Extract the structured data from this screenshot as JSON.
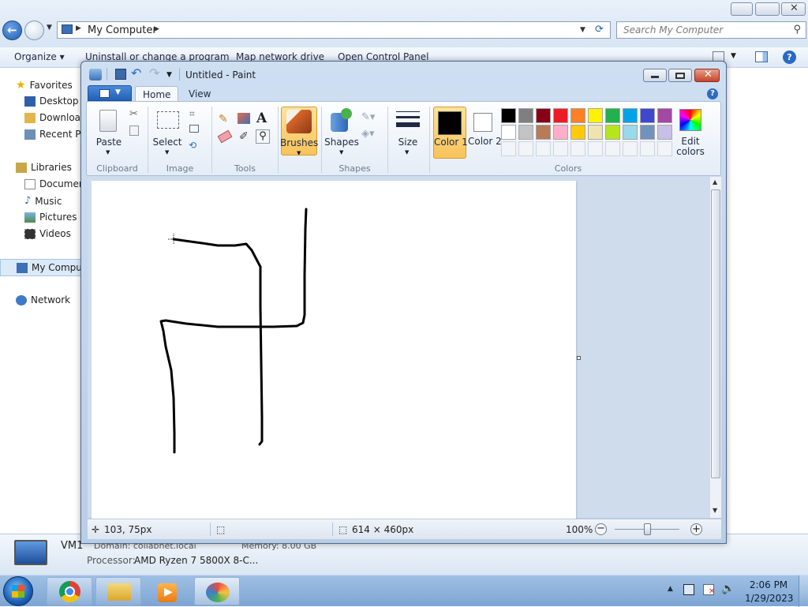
{
  "explorer": {
    "address": "My Computer",
    "search_placeholder": "Search My Computer",
    "commands": [
      "Organize",
      "Uninstall or change a program",
      "Map network drive",
      "Open Control Panel"
    ],
    "nav": {
      "favorites": "Favorites",
      "desktop": "Desktop",
      "downloads": "Download",
      "recent": "Recent Pla",
      "libraries": "Libraries",
      "documents": "Documen",
      "music": "Music",
      "pictures": "Pictures",
      "videos": "Videos",
      "computer": "My Comput",
      "network": "Network"
    },
    "details": {
      "name": "VM1",
      "domain": "Domain:  collabnet.local",
      "memory": "Memory:  8.00 GB",
      "processor_label": "Processor:",
      "processor_value": "AMD Ryzen 7 5800X 8-C..."
    }
  },
  "paint": {
    "title": "Untitled - Paint",
    "tabs": {
      "home": "Home",
      "view": "View"
    },
    "ribbon": {
      "paste": "Paste",
      "select": "Select",
      "brushes": "Brushes",
      "shapes": "Shapes",
      "size": "Size",
      "color1": "Color 1",
      "color2": "Color 2",
      "edit_colors": "Edit colors",
      "groups": {
        "clipboard": "Clipboard",
        "image": "Image",
        "tools": "Tools",
        "shapes": "Shapes",
        "colors": "Colors"
      }
    },
    "palette_row1": [
      "#000000",
      "#7f7f7f",
      "#880015",
      "#ed1c24",
      "#ff7f27",
      "#fff200",
      "#22b14c",
      "#00a2e8",
      "#3f48cc",
      "#a349a4"
    ],
    "palette_row2": [
      "#ffffff",
      "#c3c3c3",
      "#b97a57",
      "#ffaec9",
      "#ffc90e",
      "#efe4b0",
      "#b5e61d",
      "#99d9ea",
      "#7092be",
      "#c8bfe7"
    ],
    "color1_value": "#000000",
    "color2_value": "#ffffff",
    "status": {
      "cursor_pos": "103, 75px",
      "canvas_size": "614 × 460px",
      "zoom": "100%"
    }
  },
  "taskbar": {
    "time": "2:06 PM",
    "date": "1/29/2023"
  }
}
